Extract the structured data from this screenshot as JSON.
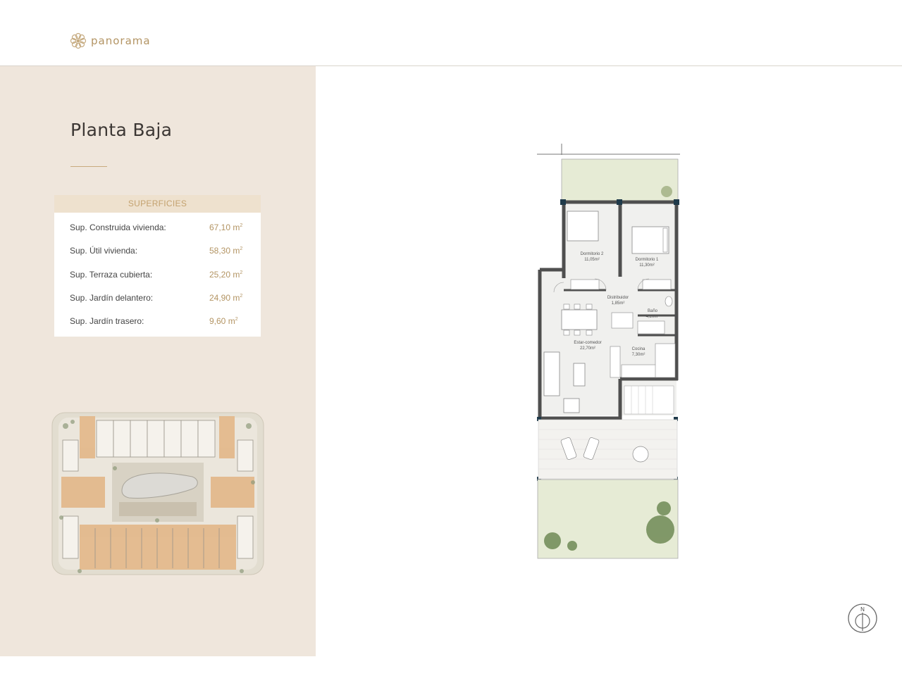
{
  "brand": {
    "name": "panorama",
    "icon": "flower-logo-icon"
  },
  "page": {
    "title": "Planta Baja"
  },
  "surfaces": {
    "heading": "SUPERFICIES",
    "rows": [
      {
        "label": "Sup. Construida vivienda:",
        "value": "67,10 m",
        "unit_sup": "2"
      },
      {
        "label": "Sup. Útil vivienda:",
        "value": "58,30 m",
        "unit_sup": "2"
      },
      {
        "label": "Sup. Terraza cubierta:",
        "value": "25,20 m",
        "unit_sup": "2"
      },
      {
        "label": "Sup. Jardín delantero:",
        "value": "24,90 m",
        "unit_sup": "2"
      },
      {
        "label": "Sup. Jardín trasero:",
        "value": "9,60 m",
        "unit_sup": "2"
      }
    ]
  },
  "floorplan": {
    "rooms": [
      {
        "name": "Dormitorio 2",
        "area": "11,05m²"
      },
      {
        "name": "Dormitorio 1",
        "area": "11,30m²"
      },
      {
        "name": "Distribuidor",
        "area": "1,85m²"
      },
      {
        "name": "Baño",
        "area": "4,20m²"
      },
      {
        "name": "Estar-comedor",
        "area": "22,70m²"
      },
      {
        "name": "Cocina",
        "area": "7,30m²"
      }
    ]
  },
  "compass": {
    "label": "N",
    "icon": "north-compass-icon"
  },
  "colors": {
    "accent": "#b39463",
    "sidebar_bg": "#efe6dc",
    "garden": "#e6ebd5",
    "wall": "#555555"
  }
}
